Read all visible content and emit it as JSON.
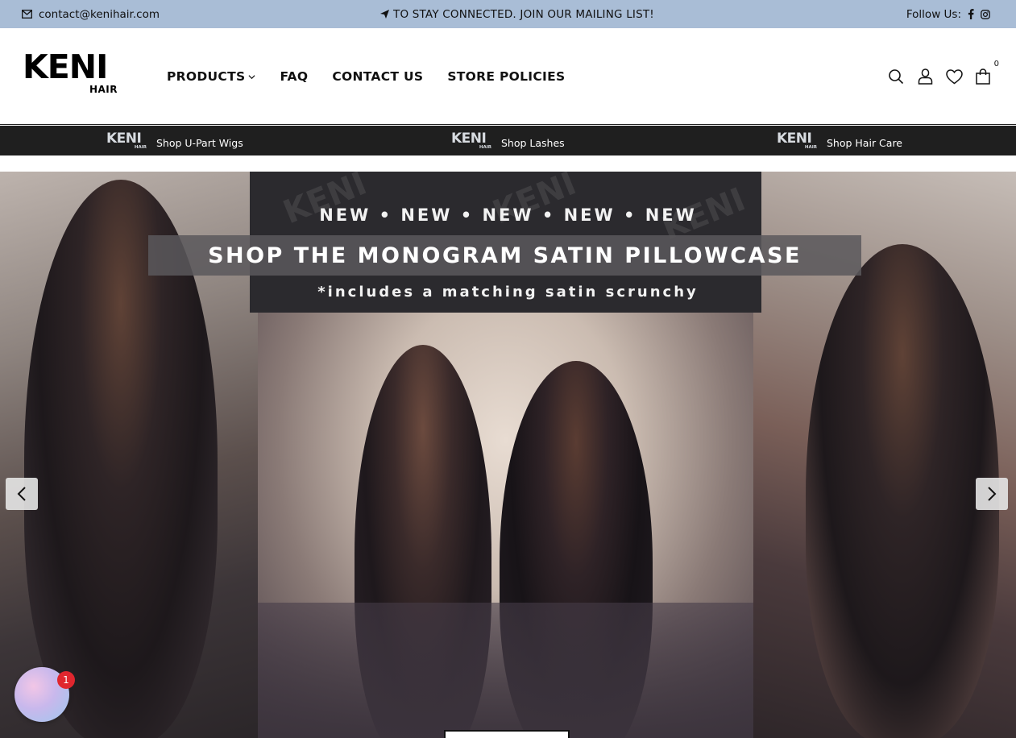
{
  "topbar": {
    "email": "contact@kenihair.com",
    "promo": "TO STAY CONNECTED. JOIN OUR MAILING LIST!",
    "follow_label": "Follow Us:",
    "background": "#a9bdd6"
  },
  "logo": {
    "main": "KENI",
    "sub": "HAIR"
  },
  "nav": {
    "products": "PRODUCTS",
    "faq": "FAQ",
    "contact": "CONTACT US",
    "policies": "STORE POLICIES"
  },
  "header_icons": {
    "search": "search-icon",
    "account": "user-icon",
    "wishlist": "heart-icon",
    "cart": "bag-icon",
    "cart_count": "0"
  },
  "strip": {
    "background": "#1f1f1f",
    "items": [
      {
        "logo_main": "KENI",
        "logo_sub": "HAIR",
        "label": "Shop U-Part Wigs"
      },
      {
        "logo_main": "KENI",
        "logo_sub": "HAIR",
        "label": "Shop Lashes"
      },
      {
        "logo_main": "KENI",
        "logo_sub": "HAIR",
        "label": "Shop Hair Care"
      }
    ]
  },
  "hero": {
    "line1": "NEW • NEW • NEW • NEW • NEW",
    "title": "SHOP THE MONOGRAM SATIN PILLOWCASE",
    "line3": "*includes a matching satin scrunchy",
    "watermark": "KENI"
  },
  "chat": {
    "badge_count": "1",
    "badge_color": "#e0262e"
  }
}
